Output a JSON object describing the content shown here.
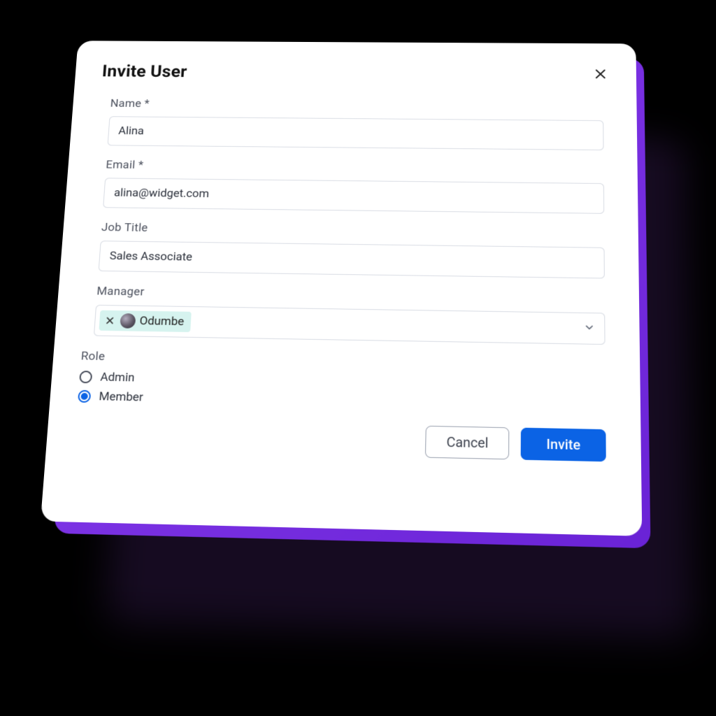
{
  "dialog": {
    "title": "Invite User",
    "fields": {
      "name": {
        "label": "Name *",
        "value": "Alina"
      },
      "email": {
        "label": "Email *",
        "value": "alina@widget.com"
      },
      "jobTitle": {
        "label": "Job Title",
        "value": "Sales Associate"
      },
      "manager": {
        "label": "Manager",
        "chip": "Odumbe"
      },
      "role": {
        "label": "Role",
        "options": [
          "Admin",
          "Member"
        ],
        "selected": "Member"
      }
    },
    "actions": {
      "cancel": "Cancel",
      "invite": "Invite"
    }
  }
}
